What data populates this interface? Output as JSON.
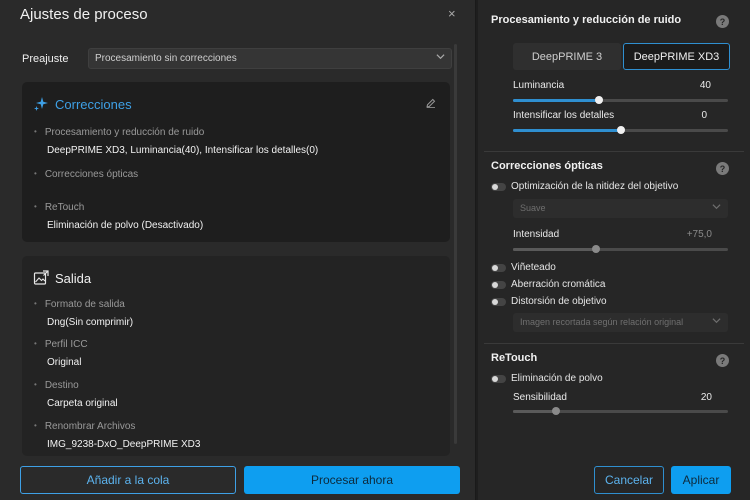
{
  "dialog": {
    "title": "Ajustes de proceso",
    "close_glyph": "×",
    "preset": {
      "label": "Preajuste",
      "value": "Procesamiento sin correcciones"
    },
    "corrections_card": {
      "title": "Correcciones",
      "icon": "sparkle-icon",
      "items": [
        {
          "label": "Procesamiento y reducción de ruido",
          "value": "DeepPRIME XD3, Luminancia(40), Intensificar los detalles(0)"
        },
        {
          "label": "Correcciones ópticas",
          "value": ""
        },
        {
          "label": "ReTouch",
          "value": "Eliminación de polvo (Desactivado)"
        }
      ]
    },
    "output_card": {
      "title": "Salida",
      "icon": "image-export-icon",
      "items": [
        {
          "label": "Formato de salida",
          "value": "Dng(Sin comprimir)"
        },
        {
          "label": "Perfil ICC",
          "value": "Original"
        },
        {
          "label": "Destino",
          "value": "Carpeta original"
        },
        {
          "label": "Renombrar Archivos",
          "value": "IMG_9238-DxO_DeepPRIME XD3"
        }
      ]
    },
    "buttons": {
      "queue": "Añadir a la cola",
      "process": "Procesar ahora"
    }
  },
  "settings": {
    "noise": {
      "title": "Procesamiento y reducción de ruido",
      "modes": [
        "DeepPRIME 3",
        "DeepPRIME XD3"
      ],
      "selected_mode": "DeepPRIME XD3",
      "luminance": {
        "label": "Luminancia",
        "value": "40",
        "fraction": 0.4
      },
      "details": {
        "label": "Intensificar los detalles",
        "value": "0",
        "fraction": 0.5
      }
    },
    "optical": {
      "title": "Correcciones ópticas",
      "sharpness": {
        "label": "Optimización de la nitidez del objetivo",
        "select": "Suave"
      },
      "intensity": {
        "label": "Intensidad",
        "value": "+75,0",
        "fraction": 0.385
      },
      "vignetting": "Viñeteado",
      "chromatic": "Aberración cromática",
      "distortion": "Distorsión de objetivo",
      "crop_select": "Imagen recortada según relación original"
    },
    "retouch": {
      "title": "ReTouch",
      "dust": "Eliminación de polvo",
      "sensitivity": {
        "label": "Sensibilidad",
        "value": "20",
        "fraction": 0.2
      }
    },
    "help_glyph": "?",
    "buttons": {
      "cancel": "Cancelar",
      "apply": "Aplicar"
    }
  },
  "colors": {
    "accent": "#0e9ef0",
    "accent_text": "#3ea0e6"
  }
}
